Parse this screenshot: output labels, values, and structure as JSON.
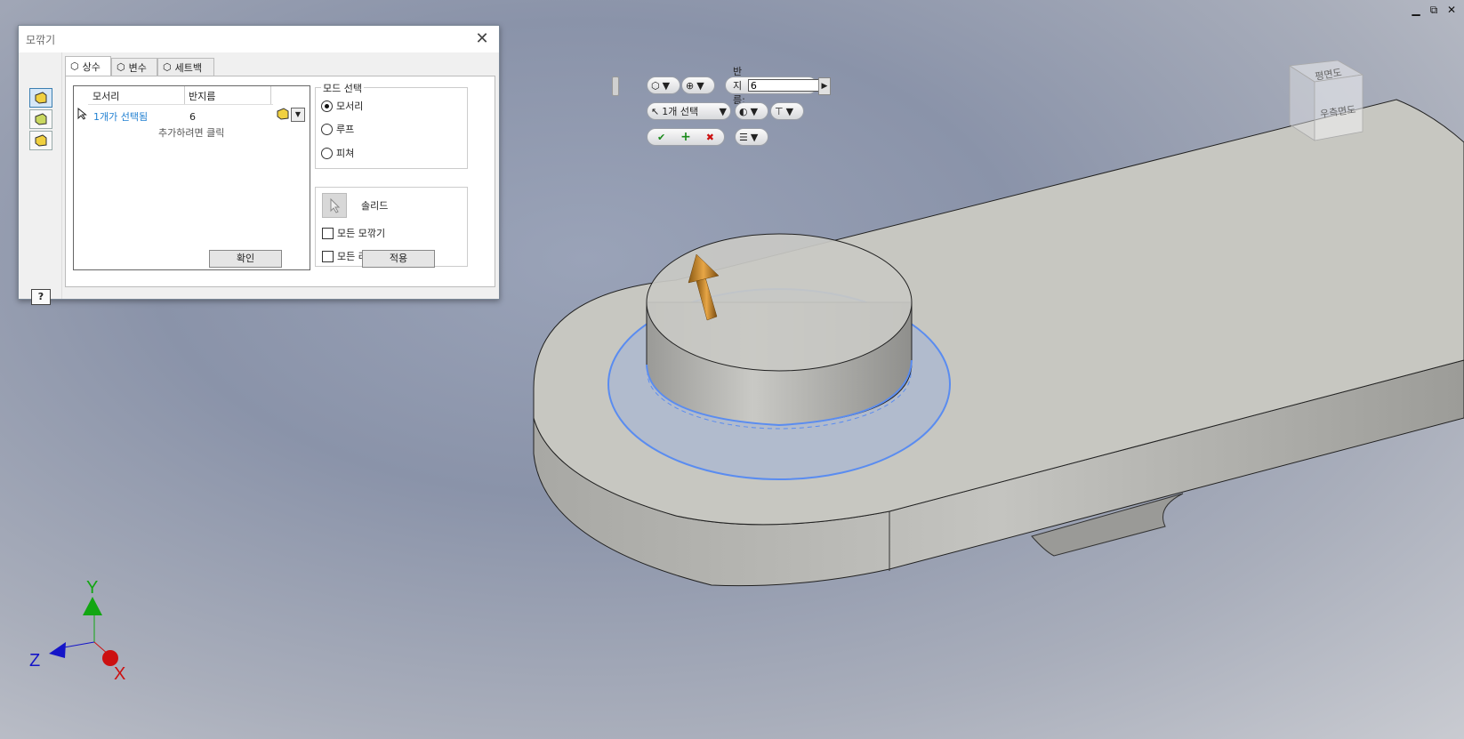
{
  "window": {
    "minimize": "▁",
    "restore": "⧉",
    "close": "✕"
  },
  "dialog": {
    "title": "모깎기",
    "close_icon": "✕",
    "tabs": [
      {
        "label": "상수"
      },
      {
        "label": "변수"
      },
      {
        "label": "세트백"
      }
    ],
    "grid": {
      "col_edges": "모서리",
      "col_radius": "반지름",
      "row": {
        "edges": "1개가 선택됨",
        "radius": "6"
      },
      "add_hint": "추가하려면 클릭"
    },
    "ok_label": "확인",
    "mode_group": {
      "legend": "모드 선택",
      "options": [
        "모서리",
        "루프",
        "피쳐"
      ],
      "selected": "모서리"
    },
    "solid_label": "솔리드",
    "check_all_fillets": "모든 모깎기",
    "check_all_rounds": "모든 라",
    "apply_label": "적용",
    "help_label": "?"
  },
  "minitoolbar": {
    "radius_label": "반지름:",
    "radius_value": "6",
    "select_label": "1개 선택"
  },
  "viewcube": {
    "front": "우측면도",
    "top": "평면도"
  },
  "axes": {
    "x": "X",
    "y": "Y",
    "z": "Z"
  },
  "colors": {
    "selection_blue": "#5a8cf0",
    "axis_x": "#cc1111",
    "axis_y": "#12a612",
    "axis_z": "#1515c8",
    "arrow": "#b8761f"
  }
}
